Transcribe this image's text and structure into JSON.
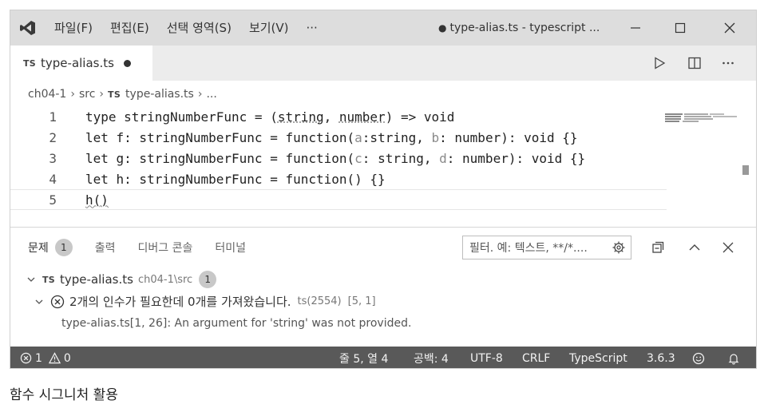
{
  "titlebar": {
    "menus": [
      "파일(F)",
      "편집(E)",
      "선택 영역(S)",
      "보기(V)",
      "···"
    ],
    "title": "type-alias.ts - typescript ...",
    "modified_dot": "●"
  },
  "tab": {
    "badge": "TS",
    "label": "type-alias.ts",
    "actions": [
      "run",
      "split",
      "more"
    ]
  },
  "breadcrumb": {
    "folder": "ch04-1",
    "sub": "src",
    "badge": "TS",
    "file": "type-alias.ts",
    "tail": "..."
  },
  "editor": {
    "lines": [
      {
        "num": "1",
        "a": "type stringNumberFunc = (",
        "b": "string",
        "c": ", ",
        "d": "number",
        "e": ") => void"
      },
      {
        "num": "2",
        "a": "let f: stringNumberFunc = function(",
        "b": "a",
        "c": ":string, ",
        "d": "b",
        "e": ": number): void {}"
      },
      {
        "num": "3",
        "a": "let g: stringNumberFunc = function(",
        "b": "c",
        "c": ": string, ",
        "d": "d",
        "e": ": number): void {}"
      },
      {
        "num": "4",
        "a": "let h: stringNumberFunc = function() {}"
      },
      {
        "num": "5",
        "a": "h()"
      }
    ]
  },
  "panel": {
    "tabs": [
      "문제",
      "출력",
      "디버그 콘솔",
      "터미널"
    ],
    "problem_count": "1",
    "filter_placeholder": "필터. 예: 텍스트, **/*....",
    "file": {
      "badge": "TS",
      "name": "type-alias.ts",
      "path": "ch04-1\\src",
      "count": "1"
    },
    "error": {
      "message": "2개의 인수가 필요한데 0개를 가져왔습니다.",
      "source": "ts(2554)",
      "position": "[5, 1]"
    },
    "detail": "type-alias.ts[1, 26]: An argument for 'string' was not provided."
  },
  "statusbar": {
    "errors": "1",
    "warnings": "0",
    "cursor": "줄 5, 열 4",
    "spaces": "공백: 4",
    "encoding": "UTF-8",
    "eol": "CRLF",
    "language": "TypeScript",
    "version": "3.6.3"
  },
  "caption": "함수 시그니처 활용"
}
